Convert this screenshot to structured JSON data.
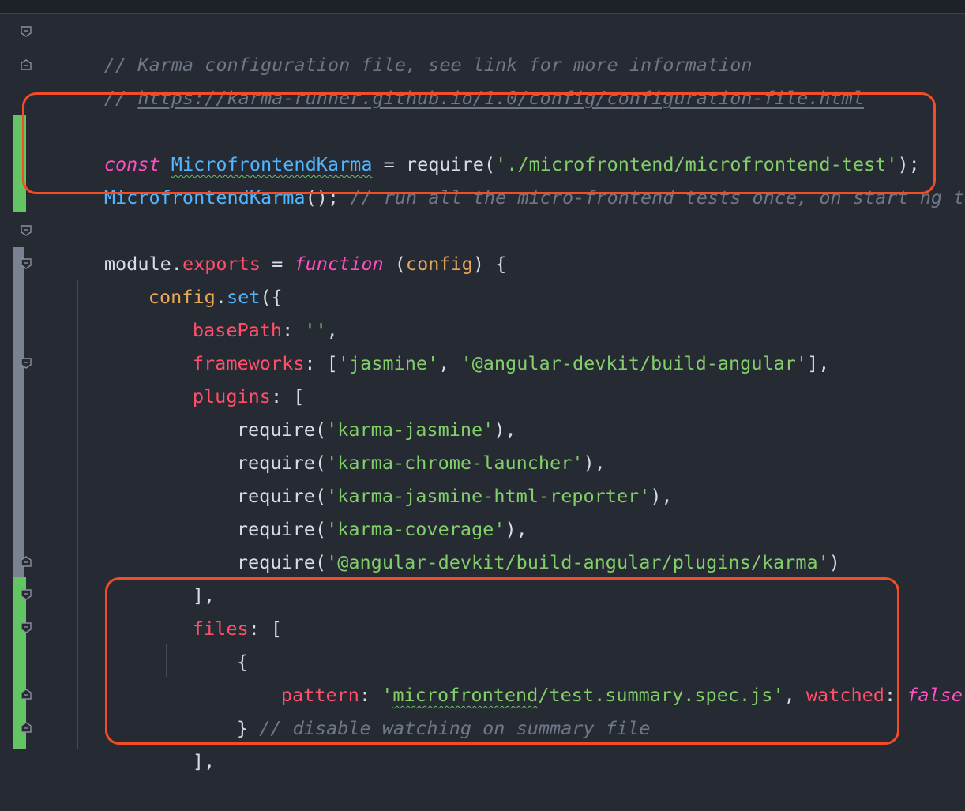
{
  "lines": [
    {
      "comment": "// Karma configuration file, see link for more information"
    },
    {
      "comment_prefix": "// ",
      "url": "https://karma-runner.github.io/1.0/config/configuration-file.html"
    },
    {},
    {
      "kw": "const",
      "name": "MicrofrontendKarma",
      "eq": " = ",
      "fn": "require",
      "open": "(",
      "arg": "'./microfrontend/microfrontend-test'",
      "close": ");"
    },
    {
      "name": "MicrofrontendKarma",
      "call": "();",
      "comment": " // run all the micro-frontend tests once, on start ng test"
    },
    {},
    {
      "obj": "module",
      "dot": ".",
      "prop": "exports",
      "eq": " = ",
      "kw": "function",
      "open": " (",
      "param": "config",
      "close": ") {"
    },
    {
      "obj": "config",
      "dot": ".",
      "method": "set",
      "open": "({"
    },
    {
      "key": "basePath",
      "colon": ": ",
      "val": "''",
      "end": ","
    },
    {
      "key": "frameworks",
      "colon": ": [",
      "v1": "'jasmine'",
      "sep": ", ",
      "v2": "'@angular-devkit/build-angular'",
      "end": "],"
    },
    {
      "key": "plugins",
      "colon": ": ["
    },
    {
      "fn": "require",
      "open": "(",
      "arg": "'karma-jasmine'",
      "close": "),"
    },
    {
      "fn": "require",
      "open": "(",
      "arg": "'karma-chrome-launcher'",
      "close": "),"
    },
    {
      "fn": "require",
      "open": "(",
      "arg": "'karma-jasmine-html-reporter'",
      "close": "),"
    },
    {
      "fn": "require",
      "open": "(",
      "arg": "'karma-coverage'",
      "close": "),"
    },
    {
      "fn": "require",
      "open": "(",
      "arg": "'@angular-devkit/build-angular/plugins/karma'",
      "close": ")"
    },
    {
      "text": "],"
    },
    {
      "key": "files",
      "colon": ": ["
    },
    {
      "text": "{"
    },
    {
      "key": "pattern",
      "colon": ": ",
      "q1": "'",
      "sq": "microfrontend",
      "rest": "/test.summary.spec.js'",
      "sep": ", ",
      "key2": "watched",
      "colon2": ": ",
      "bool": "false"
    },
    {
      "text": "}",
      "comment": " // disable watching on summary file"
    },
    {
      "text": "],"
    }
  ],
  "colors": {
    "background": "#262a33",
    "keyword": "#ff4fc5",
    "class": "#4fb6ff",
    "string": "#82cf6a",
    "comment": "#6f7787",
    "property": "#ff4f6a",
    "parameter": "#e6a85a",
    "highlight_box": "#f24d26",
    "vcs_added": "#62c462",
    "vcs_modified": "#7a8190"
  }
}
